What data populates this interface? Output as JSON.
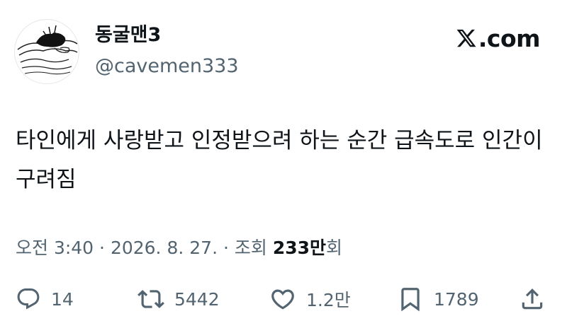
{
  "author": {
    "display_name": "동굴맨3",
    "handle": "@cavemen333",
    "avatar_icon": "cave-man-sketch-avatar"
  },
  "brand": {
    "logo_icon": "x-logo-icon",
    "domain": ".com"
  },
  "tweet": {
    "text": "타인에게 사랑받고 인정받으려 하는 순간 급속도로 인간이 구려짐"
  },
  "meta": {
    "time": "오전 3:40",
    "separator1": " · ",
    "date": "2026. 8. 27.",
    "separator2": " · ",
    "views_label": "조회",
    "views_count": "233만",
    "views_suffix": "회"
  },
  "actions": {
    "reply_icon": "reply-icon",
    "reply_count": "14",
    "retweet_icon": "retweet-icon",
    "retweet_count": "5442",
    "like_icon": "heart-icon",
    "like_count": "1.2만",
    "bookmark_icon": "bookmark-icon",
    "bookmark_count": "1789",
    "share_icon": "share-icon"
  },
  "colors": {
    "text_primary": "#0f1419",
    "text_secondary": "#536471",
    "background": "#ffffff"
  }
}
